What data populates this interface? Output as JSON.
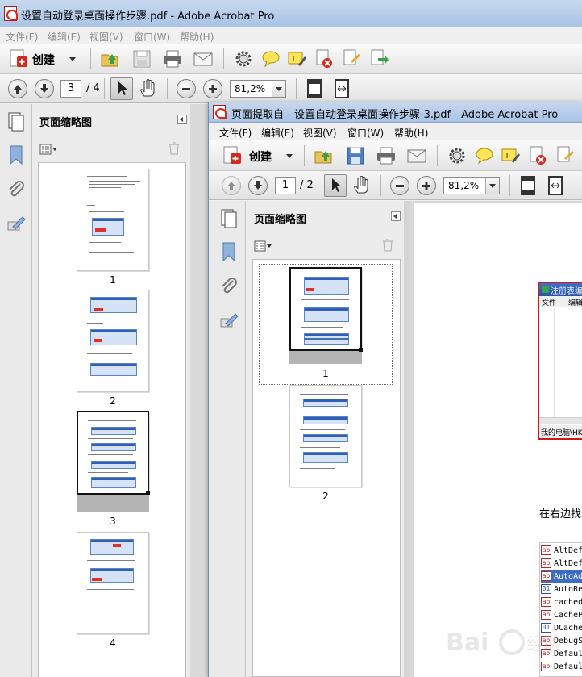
{
  "window_main": {
    "title": "设置自动登录桌面操作步骤.pdf - Adobe Acrobat Pro",
    "menu": [
      "文件(F)",
      "编辑(E)",
      "视图(V)",
      "窗口(W)",
      "帮助(H)"
    ],
    "toolbar": {
      "create_label": "创建"
    },
    "nav": {
      "current_page": "3",
      "total_pages": "/ 4",
      "zoom": "81,2%"
    },
    "panel": {
      "title": "页面缩略图",
      "pages": [
        "1",
        "2",
        "3",
        "4"
      ],
      "selected_page": "3"
    }
  },
  "window_front": {
    "title": "页面提取自 - 设置自动登录桌面操作步骤-3.pdf - Adobe Acrobat Pro",
    "menu": [
      "文件(F)",
      "编辑(E)",
      "视图(V)",
      "窗口(W)",
      "帮助(H)"
    ],
    "toolbar": {
      "create_label": "创建"
    },
    "nav": {
      "current_page": "1",
      "total_pages": "/ 2",
      "zoom": "81,2%"
    },
    "panel": {
      "title": "页面缩略图",
      "pages": [
        "1",
        "2"
      ],
      "selected_page": "1"
    },
    "document": {
      "registry_title": "注册表编辑",
      "registry_menu": [
        "文件",
        "编辑"
      ],
      "registry_status": "我的电脑\\HKEY_",
      "body_text": "在右边找",
      "value_list": [
        {
          "type": "ab",
          "name": "AltDefa"
        },
        {
          "type": "ab",
          "name": "AltDefa"
        },
        {
          "type": "ab",
          "name": "AutoAdm"
        },
        {
          "type": "bin",
          "name": "AutoRes"
        },
        {
          "type": "ab",
          "name": "cachedL"
        },
        {
          "type": "ab",
          "name": "CachePr"
        },
        {
          "type": "bin",
          "name": "DCacheU"
        },
        {
          "type": "ab",
          "name": "DebugSe"
        },
        {
          "type": "ab",
          "name": "Default"
        },
        {
          "type": "ab",
          "name": "Default"
        },
        {
          "type": "ab",
          "name": "Default"
        }
      ]
    }
  },
  "icons": [
    "pdf-icon",
    "create-icon",
    "open-icon",
    "save-icon",
    "print-icon",
    "email-icon",
    "gear-icon",
    "comment-icon",
    "highlight-icon",
    "secure-icon",
    "sign-icon",
    "share-icon",
    "prev-page-icon",
    "next-page-icon",
    "select-tool-icon",
    "hand-tool-icon",
    "zoom-out-icon",
    "zoom-in-icon",
    "fit-page-icon",
    "fit-width-icon",
    "thumbnails-icon",
    "bookmark-icon",
    "attachment-icon",
    "signature-icon",
    "options-icon",
    "trash-icon"
  ],
  "colors": {
    "title_bar": "#b8cfee",
    "accent_red": "#d3161a",
    "selection_blue": "#3b6fc7"
  },
  "watermark": "Baidu 经验"
}
